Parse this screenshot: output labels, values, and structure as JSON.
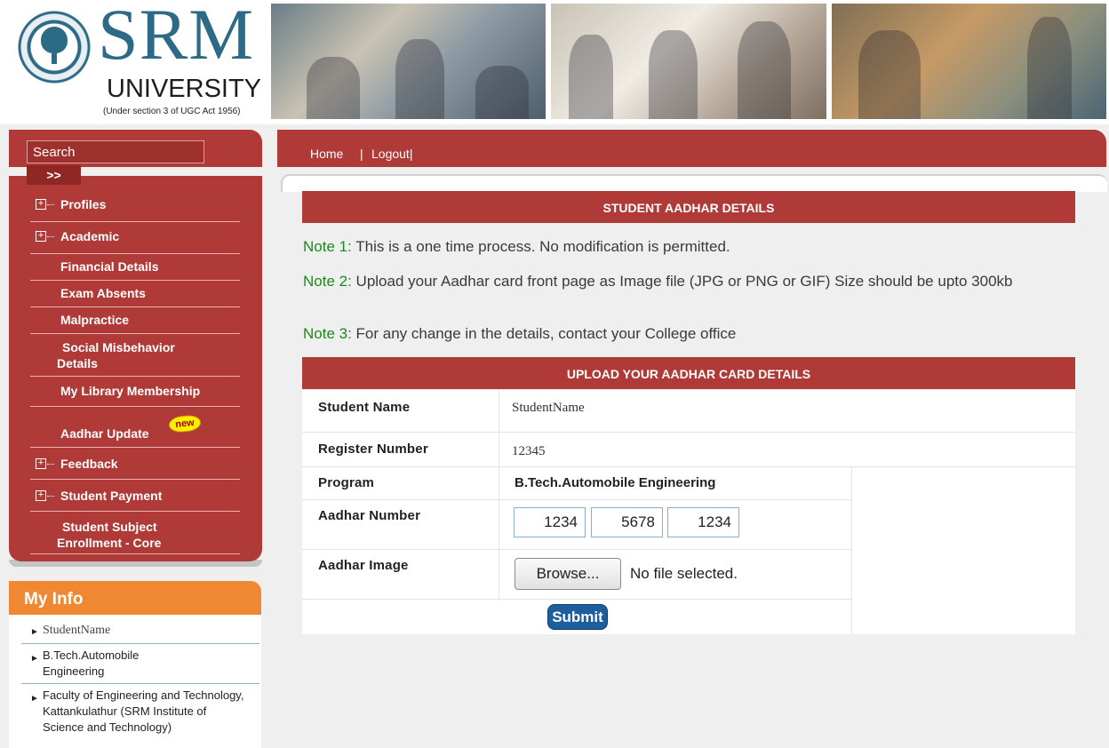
{
  "header": {
    "logo_main": "SRM",
    "logo_university": "UNIVERSITY",
    "logo_subtitle": "(Under section 3 of UGC Act 1956)"
  },
  "sidebar": {
    "search_placeholder": "Search",
    "search_go": ">>",
    "items": [
      {
        "label": "Profiles",
        "expandable": true
      },
      {
        "label": "Academic",
        "expandable": true
      },
      {
        "label": "Financial Details",
        "expandable": false
      },
      {
        "label": "Exam Absents",
        "expandable": false
      },
      {
        "label": "Malpractice",
        "expandable": false
      },
      {
        "label": "Social Misbehavior Details",
        "expandable": false
      },
      {
        "label": "My Library Membership",
        "expandable": false
      },
      {
        "label": "Aadhar Update",
        "expandable": false,
        "badge": "new"
      },
      {
        "label": "Feedback",
        "expandable": true
      },
      {
        "label": "Student Payment",
        "expandable": true
      },
      {
        "label": "Student Subject Enrollment - Core",
        "expandable": false
      }
    ],
    "expand_glyph": "+"
  },
  "myinfo": {
    "title": "My Info",
    "rows": [
      {
        "text": "StudentName"
      },
      {
        "text": "B.Tech.Automobile Engineering"
      },
      {
        "text": "Faculty of Engineering and Technology, Kattankulathur (SRM Institute of Science and Technology)"
      }
    ]
  },
  "topnav": {
    "home": "Home",
    "separator": "|",
    "logout": "Logout|"
  },
  "main": {
    "section_title": "STUDENT AADHAR DETAILS",
    "notes": [
      {
        "tag": "Note 1:",
        "text": "This is a one time process. No modification is permitted."
      },
      {
        "tag": "Note 2:",
        "text": "Upload your Aadhar card front page as Image file (JPG or PNG or GIF) Size should be upto 300kb"
      },
      {
        "tag": "Note 3:",
        "text": "For any change in the details, contact your College office"
      }
    ],
    "form_title": "UPLOAD YOUR AADHAR CARD DETAILS",
    "fields": {
      "student_name_label": "Student Name",
      "student_name_value": "StudentName",
      "register_label": "Register Number",
      "register_value": "12345",
      "program_label": "Program",
      "program_value": "B.Tech.Automobile Engineering",
      "aadhar_label": "Aadhar Number",
      "aadhar_parts": [
        "1234",
        "5678",
        "1234"
      ],
      "image_label": "Aadhar Image",
      "browse_label": "Browse...",
      "no_file": "No file selected."
    },
    "submit_label": "Submit"
  },
  "colors": {
    "maroon": "#b03a37",
    "orange": "#f08733",
    "note_green": "#1a8a1a",
    "brand_blue": "#2d6a86"
  }
}
